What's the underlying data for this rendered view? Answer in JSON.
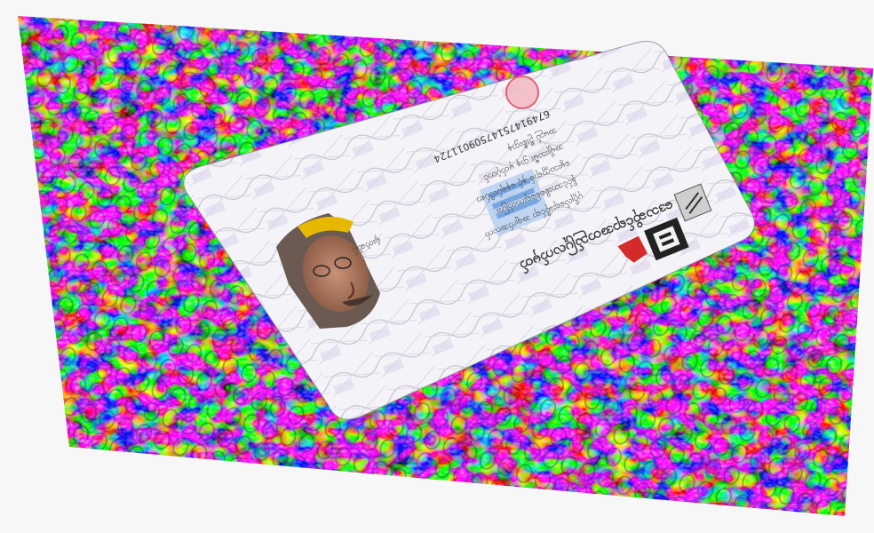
{
  "image": {
    "subject": "identity card photo",
    "card": {
      "orientation": "upside-down",
      "title_text": "ဒေသဆိုင်ရာအတည်ပြုလက်မှတ်",
      "id_number": "6749147514750901​1724",
      "lines": [
        "ပုဂ္ဂိုလ်ရေးဆိုင်ရာ အချက်အလက်",
        "နိုင်ငံသားစိစစ်ရေးကတ်ပြား",
        "မွေးသက္ကရာဇ် နှင့် နေရပ်လိပ်စာ",
        "အမျိုးသမီး ဌာန မှတ်ပုံတင်",
        "အမည် ဦးစီးဌာန",
        "ရုံးတံဆိပ်"
      ],
      "accent_colors": {
        "title": "#5a62d8",
        "stamp": "#e04b5e",
        "logo": "#d42a2a",
        "photo_shirt": "#e6b800"
      }
    },
    "background": "psychedelic rainbow textured fabric"
  }
}
